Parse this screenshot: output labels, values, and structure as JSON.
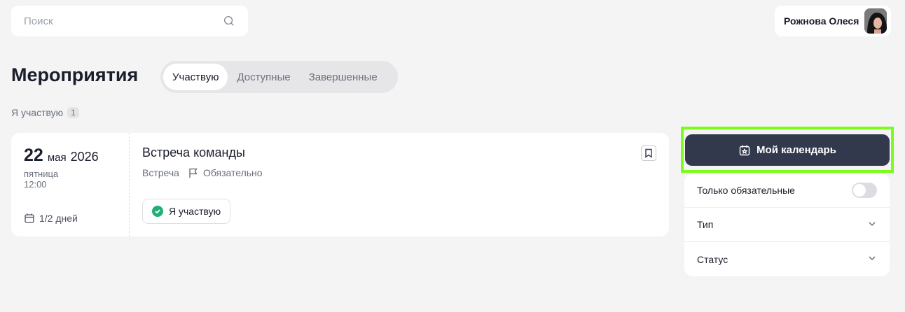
{
  "search": {
    "placeholder": "Поиск",
    "icon": "search-icon"
  },
  "user": {
    "name": "Рожнова Олеся"
  },
  "page": {
    "title": "Мероприятия"
  },
  "tabs": [
    {
      "label": "Участвую",
      "active": true
    },
    {
      "label": "Доступные",
      "active": false
    },
    {
      "label": "Завершенные",
      "active": false
    }
  ],
  "section": {
    "label": "Я участвую",
    "count": "1"
  },
  "event": {
    "day": "22",
    "month": "мая",
    "year": "2026",
    "weekday": "пятница",
    "time": "12:00",
    "duration": "1/2 дней",
    "title": "Встреча команды",
    "type": "Встреча",
    "mandatory": "Обязательно",
    "status": "Я участвую"
  },
  "calendar_button": {
    "label": "Мой календарь"
  },
  "filters": {
    "mandatory_only": {
      "label": "Только обязательные",
      "enabled": false
    },
    "type": {
      "label": "Тип"
    },
    "status": {
      "label": "Статус"
    }
  },
  "colors": {
    "background": "#f4f4f5",
    "primary_button": "#33394d",
    "highlight": "#7cfc1a",
    "success": "#1fb07a"
  }
}
